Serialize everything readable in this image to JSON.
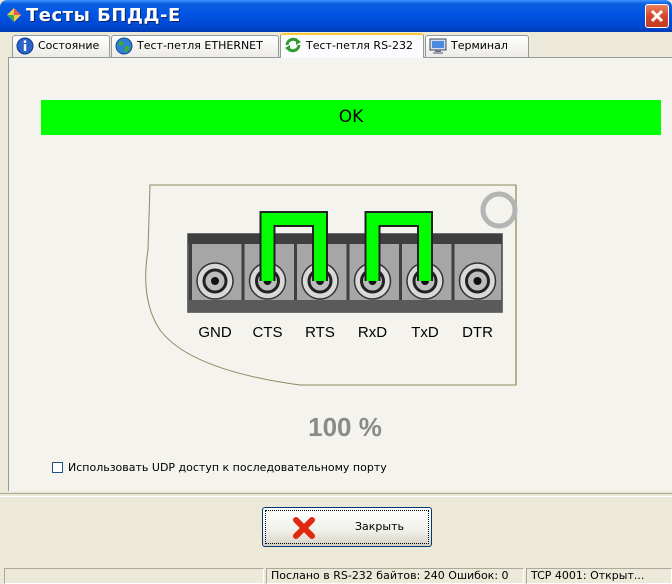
{
  "window": {
    "title": "Тесты БПДД-Е"
  },
  "tabs": [
    {
      "label": "Состояние",
      "icon": "info-icon"
    },
    {
      "label": "Тест-петля ETHERNET",
      "icon": "globe-icon"
    },
    {
      "label": "Тест-петля RS-232",
      "icon": "refresh-icon",
      "active": true
    },
    {
      "label": "Терминал",
      "icon": "monitor-icon"
    }
  ],
  "result": {
    "status": "OK",
    "progress_text": "100 %",
    "progress": 100,
    "status_color": "#00ff00"
  },
  "connector": {
    "pins": [
      "GND",
      "CTS",
      "RTS",
      "RxD",
      "TxD",
      "DTR"
    ],
    "loops": [
      [
        "CTS",
        "RTS"
      ],
      [
        "RxD",
        "TxD"
      ]
    ],
    "loop_color": "#00ff00"
  },
  "options": {
    "udp_label": "Использовать UDP доступ к последовательному порту",
    "udp_checked": false
  },
  "buttons": {
    "close_label": "Закрыть"
  },
  "statusbar": {
    "cells": [
      "",
      "Послано в RS-232 байтов: 240 Ошибок: 0",
      "TCP 4001: Открыт..."
    ]
  }
}
